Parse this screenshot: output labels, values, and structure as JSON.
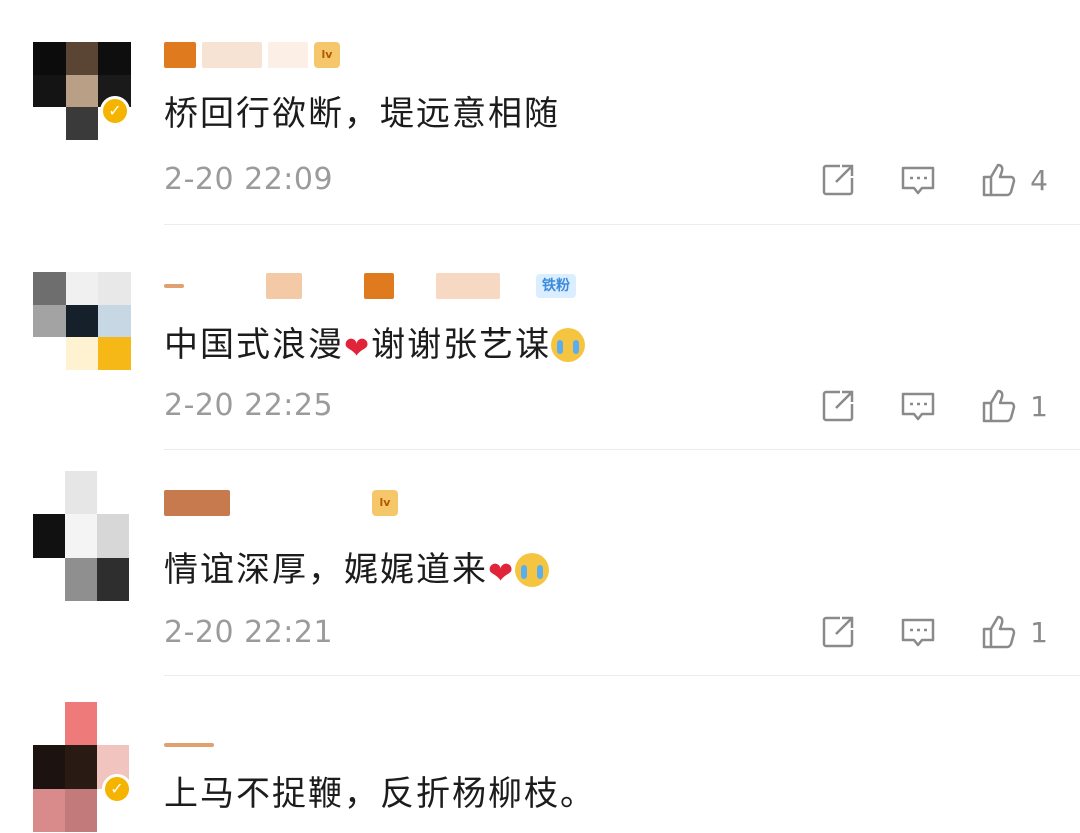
{
  "comments": [
    {
      "text": "桥回行欲断，堤远意相随",
      "time": "2-20 22:09",
      "likes": "4",
      "has_fans_badge": false
    },
    {
      "text": "中国式浪漫",
      "text2": "谢谢张艺谋",
      "time": "2-20 22:25",
      "likes": "1",
      "fans_badge_text": "铁粉"
    },
    {
      "text": "情谊深厚，娓娓道来",
      "time": "2-20 22:21",
      "likes": "1"
    },
    {
      "text": "上马不捉鞭，反折杨柳枝。"
    }
  ],
  "icons": {
    "share": "share-icon",
    "comment": "comment-icon",
    "like": "thumbs-up-icon",
    "heart": "red-heart-emoji",
    "cry": "crying-face-emoji"
  },
  "colors": {
    "text": "#1c1c1c",
    "meta": "#9b9b9b",
    "heart": "#e0253a",
    "badge": "#f4b400"
  }
}
